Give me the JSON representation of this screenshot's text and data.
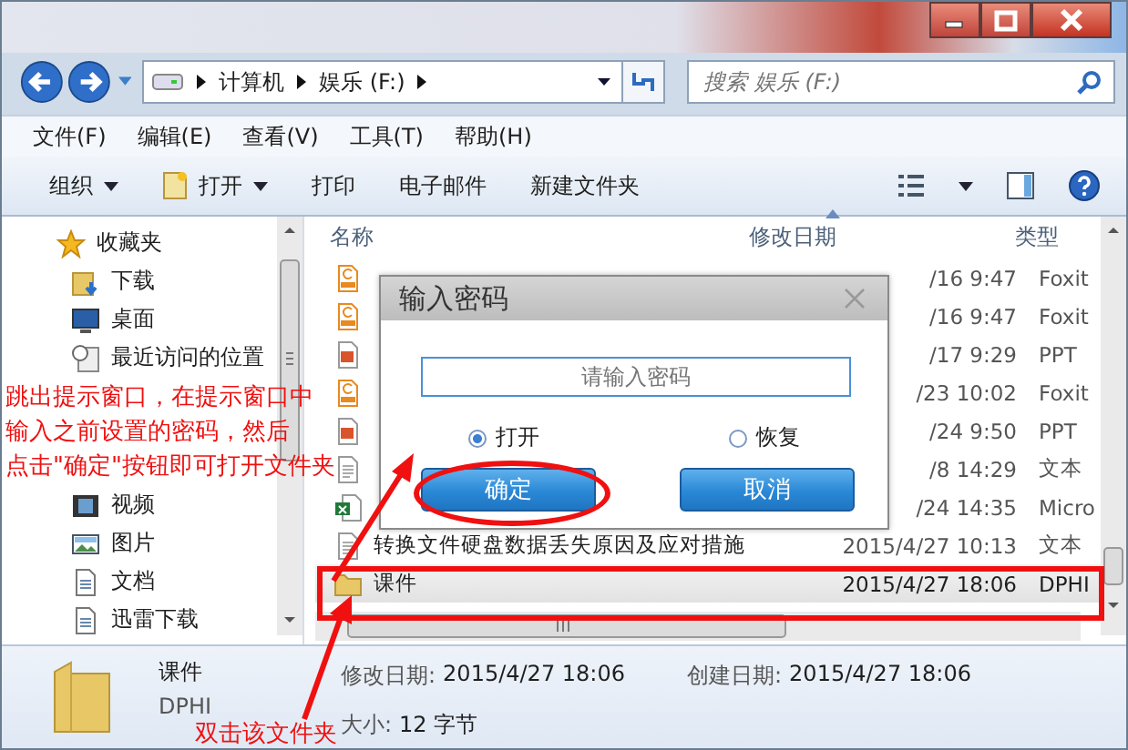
{
  "address_bar": {
    "crumbs": [
      "计算机",
      "娱乐 (F:)"
    ]
  },
  "search": {
    "placeholder": "搜索 娱乐 (F:)"
  },
  "menu_bar": [
    "文件(F)",
    "编辑(E)",
    "查看(V)",
    "工具(T)",
    "帮助(H)"
  ],
  "toolbar": [
    {
      "label": "组织",
      "kind": "dropdown"
    },
    {
      "label": "打开",
      "kind": "open"
    },
    {
      "label": "打印",
      "kind": "plain"
    },
    {
      "label": "电子邮件",
      "kind": "plain"
    },
    {
      "label": "新建文件夹",
      "kind": "plain"
    }
  ],
  "sidebar": {
    "items": [
      {
        "label": "收藏夹",
        "kind": "star"
      },
      {
        "label": "下载",
        "kind": "download"
      },
      {
        "label": "桌面",
        "kind": "desktop"
      },
      {
        "label": "最近访问的位置",
        "kind": "recent"
      },
      {
        "label": "视频",
        "kind": "video"
      },
      {
        "label": "图片",
        "kind": "picture"
      },
      {
        "label": "文档",
        "kind": "document"
      },
      {
        "label": "迅雷下载",
        "kind": "document"
      }
    ]
  },
  "file_list": {
    "columns": [
      "名称",
      "修改日期",
      "类型"
    ],
    "rows": [
      {
        "kind": "pdf",
        "modified": "/16 9:47",
        "type": "Foxit",
        "selected": false
      },
      {
        "kind": "pdf",
        "modified": "/16 9:47",
        "type": "Foxit",
        "selected": false
      },
      {
        "kind": "ppt",
        "modified": "/17 9:29",
        "type": "PPT",
        "selected": false
      },
      {
        "kind": "pdf",
        "modified": "/23 10:02",
        "type": "Foxit",
        "selected": false
      },
      {
        "kind": "ppt",
        "modified": "/24 9:50",
        "type": "PPT",
        "selected": false
      },
      {
        "kind": "text",
        "modified": "/8 14:29",
        "type": "文本",
        "selected": false
      },
      {
        "kind": "excel",
        "modified": "/24 14:35",
        "type": "Micro",
        "selected": false
      },
      {
        "kind": "text",
        "name": "转换文件硬盘数据丢失原因及应对措施",
        "modified": "2015/4/27 10:13",
        "type": "文本",
        "selected": false
      },
      {
        "kind": "folder",
        "name": "课件",
        "modified": "2015/4/27 18:06",
        "type": "DPHI",
        "selected": true
      }
    ]
  },
  "details": {
    "name": "课件",
    "type": "DPHI",
    "fields": [
      {
        "label": "修改日期:",
        "value": "2015/4/27 18:06"
      },
      {
        "label": "大小:",
        "value": "12 字节"
      },
      {
        "label": "创建日期:",
        "value": "2015/4/27 18:06"
      }
    ]
  },
  "dialog": {
    "title": "输入密码",
    "input": {
      "placeholder": "请输入密码"
    },
    "options": [
      {
        "label": "打开",
        "selected": true
      },
      {
        "label": "恢复",
        "selected": false
      }
    ],
    "buttons": [
      {
        "label": "确定",
        "highlighted": true
      },
      {
        "label": "取消",
        "highlighted": false
      }
    ]
  },
  "annotations": {
    "instruction": [
      "跳出提示窗口，在提示窗口中",
      "输入之前设置的密码，然后",
      "点击\"确定\"按钮即可打开文件夹"
    ],
    "folder_hint": "双击该文件夹"
  }
}
